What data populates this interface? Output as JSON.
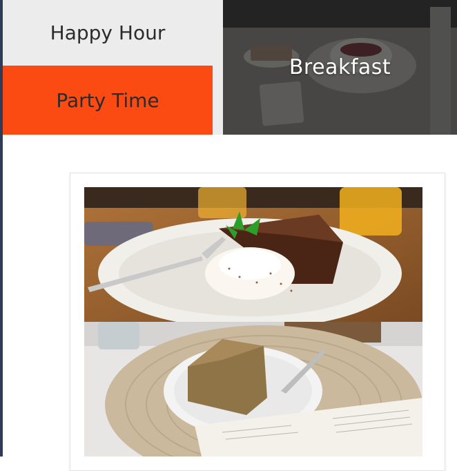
{
  "menu": {
    "items": [
      {
        "label": "Happy Hour",
        "active": false
      },
      {
        "label": "Party Time",
        "active": true
      }
    ]
  },
  "hero": {
    "label": "Breakfast"
  },
  "colors": {
    "accent": "#fb4a12",
    "menu_bg": "#ececec",
    "text": "#2b2b2b"
  },
  "gallery": {
    "images": [
      {
        "name": "chocolate-cake-with-cream-photo"
      },
      {
        "name": "sponge-cake-on-plate-photo"
      }
    ]
  }
}
